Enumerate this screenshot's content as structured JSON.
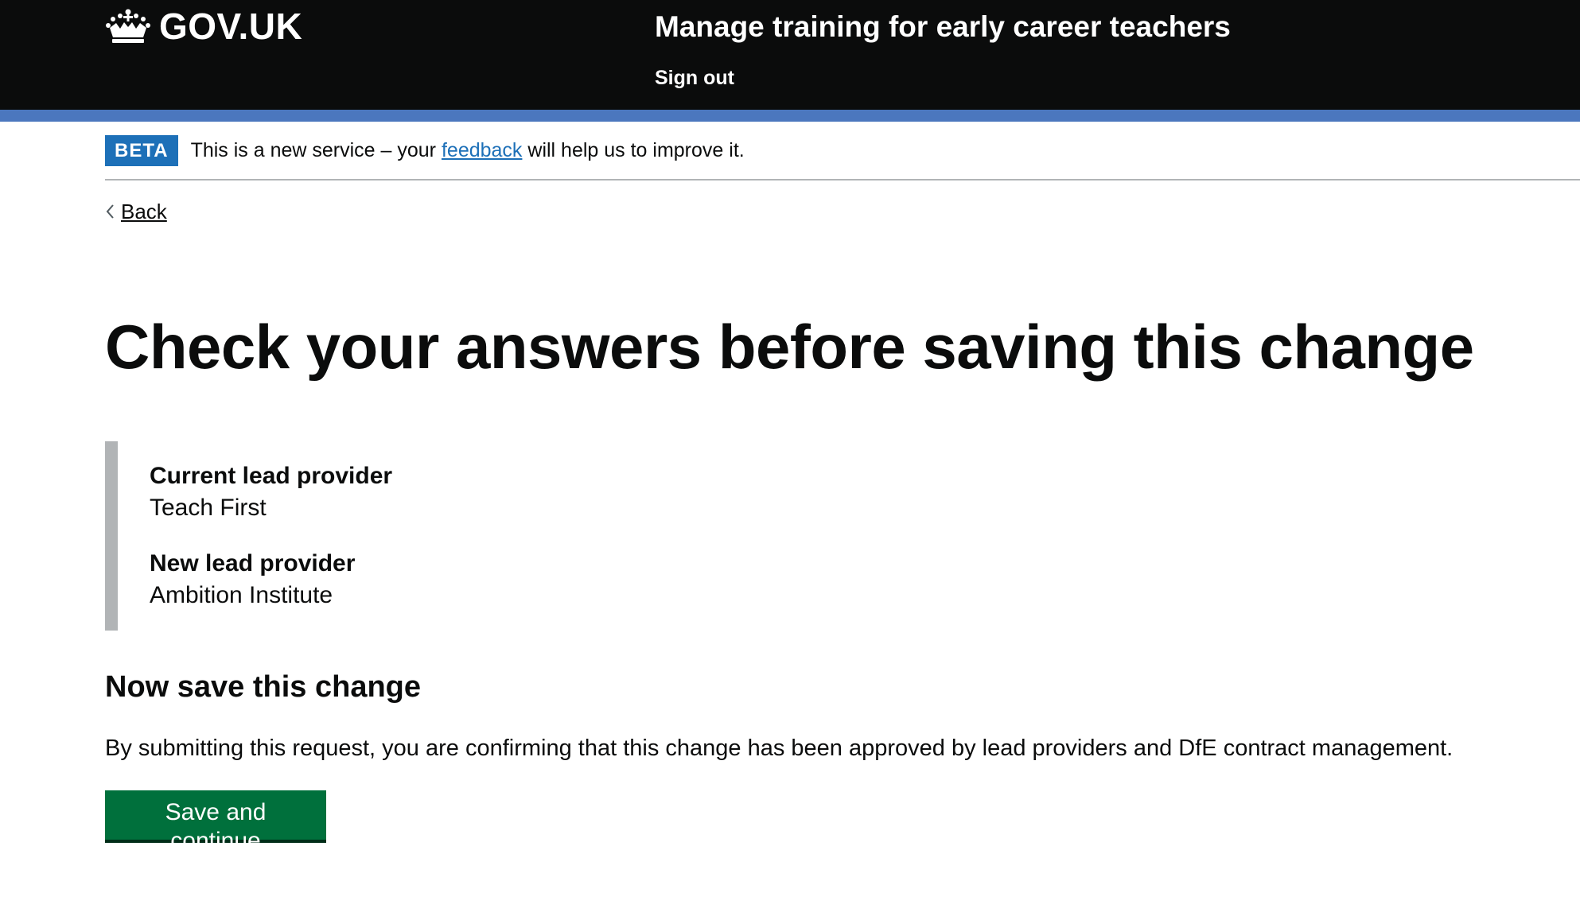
{
  "header": {
    "logo_text": "GOV.UK",
    "service_name": "Manage training for early career teachers",
    "sign_out_label": "Sign out"
  },
  "phase_banner": {
    "tag": "BETA",
    "text_before": "This is a new service – your ",
    "link_text": "feedback",
    "text_after": " will help us to improve it."
  },
  "back_link": {
    "label": "Back"
  },
  "main": {
    "title": "Check your answers before saving this change",
    "summary": [
      {
        "key": "Current lead provider",
        "value": "Teach First"
      },
      {
        "key": "New lead provider",
        "value": "Ambition Institute"
      }
    ],
    "save_heading": "Now save this change",
    "confirmation_text": "By submitting this request, you are confirming that this change has been approved by lead providers and DfE contract management.",
    "save_button_label": "Save and continue"
  },
  "colors": {
    "header_bg": "#0b0c0c",
    "header_accent": "#4b77be",
    "phase_tag": "#1d70b8",
    "link": "#1d70b8",
    "button": "#00703c",
    "inset_border": "#b1b4b6"
  },
  "icons": {
    "logo": "crown-icon",
    "back": "chevron-left-icon"
  }
}
